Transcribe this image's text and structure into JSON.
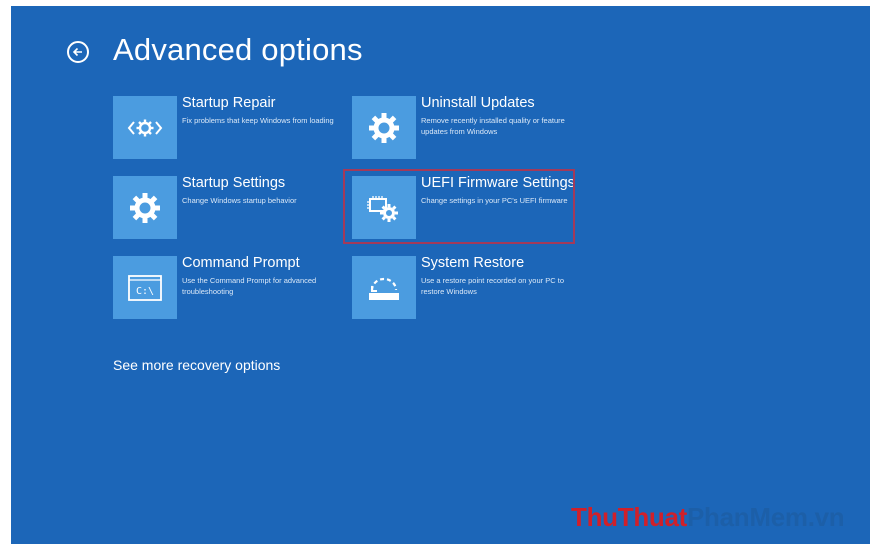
{
  "page": {
    "title": "Advanced options",
    "more_link": "See more recovery options"
  },
  "tiles": [
    {
      "title": "Startup Repair",
      "description": "Fix problems that keep Windows from loading",
      "icon": "startup-repair-icon"
    },
    {
      "title": "Uninstall Updates",
      "description": "Remove recently installed quality or feature updates from Windows",
      "icon": "gear-icon"
    },
    {
      "title": "Startup Settings",
      "description": "Change Windows startup behavior",
      "icon": "gear-icon"
    },
    {
      "title": "UEFI Firmware Settings",
      "description": "Change settings in your PC's UEFI firmware",
      "icon": "firmware-chip-gear-icon"
    },
    {
      "title": "Command Prompt",
      "description": "Use the Command Prompt for advanced troubleshooting",
      "icon": "command-prompt-icon"
    },
    {
      "title": "System Restore",
      "description": "Use a restore point recorded on your PC to restore Windows",
      "icon": "system-restore-icon"
    }
  ],
  "command_prompt_icon_text": "C:\\",
  "watermark": {
    "part1": "ThuThuat",
    "part2": "PhanMem",
    "part3": ".vn"
  },
  "colors": {
    "background": "#1c66b8",
    "tile_icon": "#4b9ce0",
    "highlight": "#a33a5a",
    "watermark_red": "#d0202a",
    "watermark_blue": "#1c5fa8"
  }
}
